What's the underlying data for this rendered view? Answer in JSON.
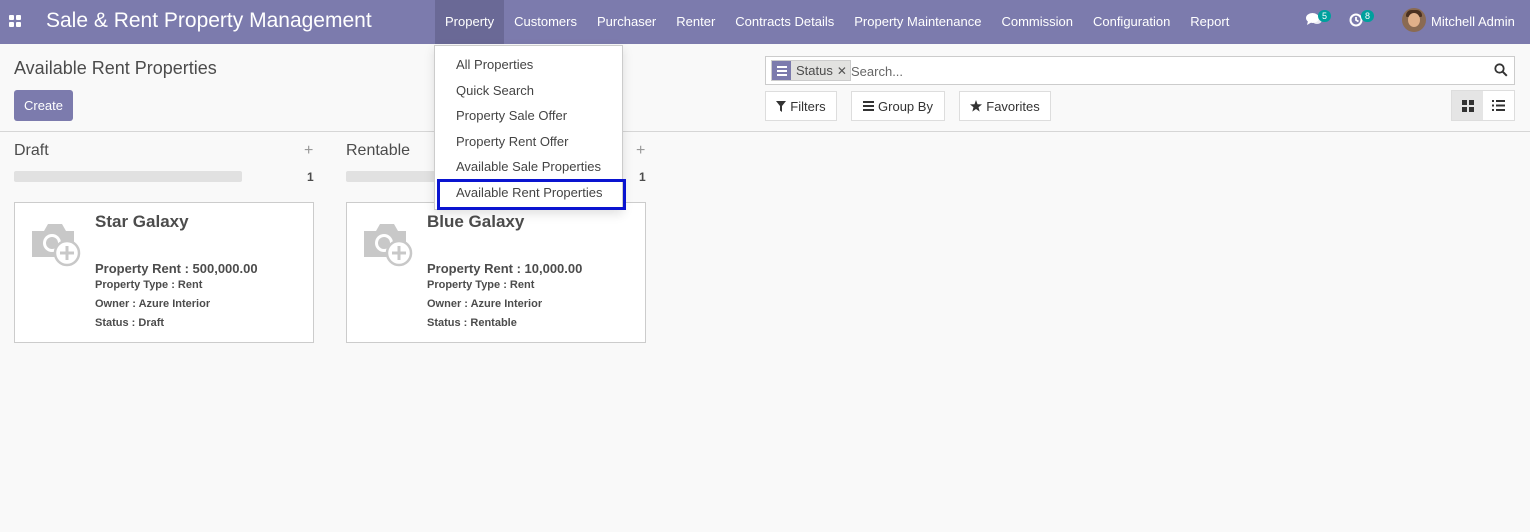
{
  "app": {
    "title": "Sale & Rent Property Management"
  },
  "menu": [
    {
      "label": "Property",
      "active": true
    },
    {
      "label": "Customers"
    },
    {
      "label": "Purchaser"
    },
    {
      "label": "Renter"
    },
    {
      "label": "Contracts Details"
    },
    {
      "label": "Property Maintenance"
    },
    {
      "label": "Commission"
    },
    {
      "label": "Configuration"
    },
    {
      "label": "Report"
    }
  ],
  "systray": {
    "messages_count": "5",
    "activities_count": "8",
    "user_name": "Mitchell Admin"
  },
  "breadcrumb": "Available Rent Properties",
  "create_label": "Create",
  "search": {
    "facet_label": "Status",
    "placeholder": "Search..."
  },
  "filters": {
    "filters_label": "Filters",
    "group_by_label": "Group By",
    "favorites_label": "Favorites"
  },
  "property_dropdown": {
    "items": [
      "All Properties",
      "Quick Search",
      "Property Sale Offer",
      "Property Rent Offer",
      "Available Sale Properties",
      "Available Rent Properties"
    ],
    "highlighted": "Available Rent Properties"
  },
  "columns": [
    {
      "title": "Draft",
      "count": "1",
      "cards": [
        {
          "name": "Star Galaxy",
          "rent": "Property Rent : 500,000.00",
          "type": "Property Type : Rent",
          "owner": "Owner : Azure Interior",
          "status": "Status : Draft"
        }
      ]
    },
    {
      "title": "Rentable",
      "count": "1",
      "cards": [
        {
          "name": "Blue Galaxy",
          "rent": "Property Rent : 10,000.00",
          "type": "Property Type : Rent",
          "owner": "Owner : Azure Interior",
          "status": "Status : Rentable"
        }
      ]
    }
  ],
  "colors": {
    "navbar": "#7c7bad",
    "navbar_active": "#6a6996",
    "badge": "#00a09d",
    "highlight_box": "#0a14d0"
  }
}
